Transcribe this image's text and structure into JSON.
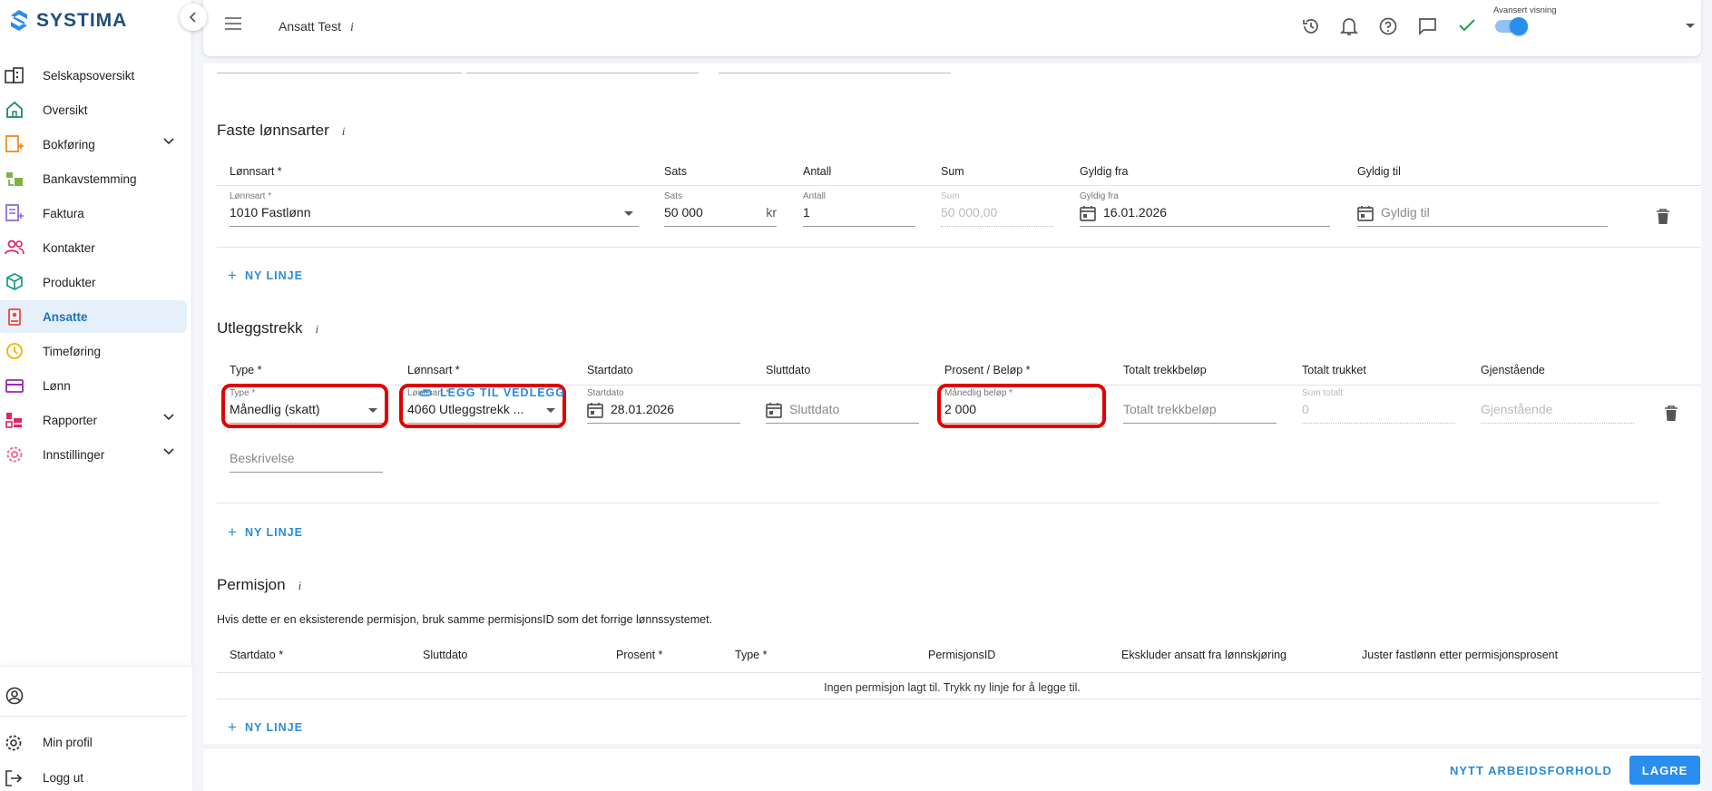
{
  "app": {
    "logo_text": "SYSTIMA"
  },
  "sidebar": {
    "items": [
      {
        "label": "Selskapsoversikt",
        "icon": "building-icon",
        "color": "#333333"
      },
      {
        "label": "Oversikt",
        "icon": "home-icon",
        "color": "#1a8a6a"
      },
      {
        "label": "Bokføring",
        "icon": "ledger-icon",
        "color": "#f08a1c",
        "expandable": true
      },
      {
        "label": "Bankavstemming",
        "icon": "bank-icon",
        "color": "#7cb342"
      },
      {
        "label": "Faktura",
        "icon": "invoice-icon",
        "color": "#8e6bd8"
      },
      {
        "label": "Kontakter",
        "icon": "people-icon",
        "color": "#e0245e"
      },
      {
        "label": "Produkter",
        "icon": "box-icon",
        "color": "#1a9a8a"
      },
      {
        "label": "Ansatte",
        "icon": "badge-icon",
        "color": "#e84a3a",
        "active": true
      },
      {
        "label": "Timeføring",
        "icon": "clock-icon",
        "color": "#f0b400"
      },
      {
        "label": "Lønn",
        "icon": "wallet-icon",
        "color": "#9c27b0"
      },
      {
        "label": "Rapporter",
        "icon": "chart-icon",
        "color": "#e0245e",
        "expandable": true
      },
      {
        "label": "Innstillinger",
        "icon": "gear-icon",
        "color": "#f06292",
        "expandable": true
      }
    ],
    "bottom": {
      "profile_label": "Min profil",
      "logout_label": "Logg ut"
    }
  },
  "topbar": {
    "title": "Ansatt Test",
    "info": "i",
    "advanced_label": "Avansert visning",
    "advanced_on": true
  },
  "faste": {
    "title": "Faste lønnsarter",
    "info": "i",
    "headers": [
      "Lønnsart *",
      "Sats",
      "Antall",
      "Sum",
      "Gyldig fra",
      "Gyldig til"
    ],
    "row": {
      "lonnsart_label": "Lønnsart *",
      "lonnsart_value": "1010 Fastlønn",
      "sats_label": "Sats",
      "sats_value": "50 000",
      "sats_suffix": "kr",
      "antall_label": "Antall",
      "antall_value": "1",
      "sum_label": "Sum",
      "sum_value": "50 000,00",
      "fra_label": "Gyldig fra",
      "fra_value": "16.01.2026",
      "til_placeholder": "Gyldig til"
    },
    "add_label": "NY LINJE"
  },
  "utlegg": {
    "title": "Utleggstrekk",
    "info": "i",
    "headers": [
      "Type *",
      "Lønnsart *",
      "Startdato",
      "Sluttdato",
      "Prosent / Beløp *",
      "Totalt trekkbeløp",
      "Totalt trukket",
      "Gjenstående"
    ],
    "row": {
      "type_label": "Type *",
      "type_value": "Månedlig (skatt)",
      "lonnsart_label": "Lønnsart *",
      "lonnsart_value": "4060 Utleggstrekk ...",
      "start_label": "Startdato",
      "start_value": "28.01.2026",
      "slutt_placeholder": "Sluttdato",
      "belop_label": "Månedlig beløp *",
      "belop_value": "2 000",
      "totalt_placeholder": "Totalt trekkbeløp",
      "trukket_label": "Sum totalt",
      "trukket_value": "0",
      "gjen_placeholder": "Gjenstående"
    },
    "desc_placeholder": "Beskrivelse",
    "attach_label": "LEGG TIL VEDLEGG",
    "add_label": "NY LINJE"
  },
  "permisjon": {
    "title": "Permisjon",
    "info": "i",
    "description": "Hvis dette er en eksisterende permisjon, bruk samme permisjonsID som det forrige lønnssystemet.",
    "headers": [
      "Startdato *",
      "Sluttdato",
      "Prosent *",
      "Type *",
      "PermisjonsID",
      "Ekskluder ansatt fra lønnskjøring",
      "Juster fastlønn etter permisjonsprosent"
    ],
    "empty_text": "Ingen permisjon lagt til. Trykk ny linje for å legge til.",
    "add_label": "NY LINJE"
  },
  "footer": {
    "new_employment_label": "NYTT ARBEIDSFORHOLD",
    "save_label": "LAGRE"
  },
  "colors": {
    "accent": "#2a8df0",
    "link": "#2a8bd8",
    "highlight": "#e10000",
    "active_bg": "#e5f0fb"
  }
}
